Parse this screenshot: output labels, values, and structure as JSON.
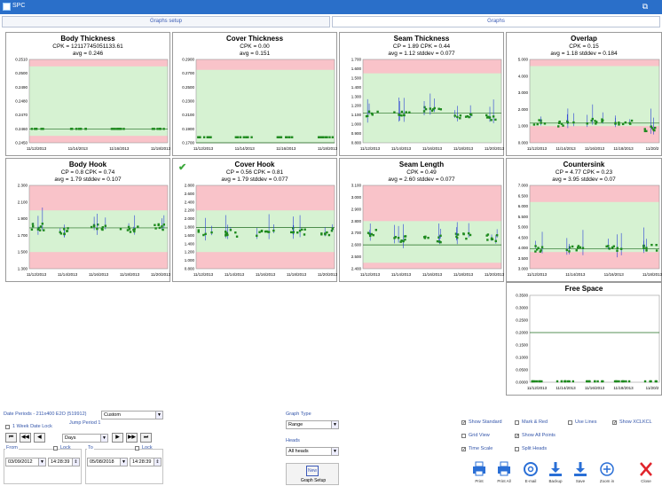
{
  "window": {
    "title": "SPC",
    "restore_glyph": "⧉"
  },
  "tabs": [
    {
      "label": "Graphs setup"
    },
    {
      "label": "Graphs"
    }
  ],
  "charts": [
    {
      "title": "Body Thickness",
      "stats": [
        "CPK = 12117745051133.61",
        "avg = 0.246"
      ],
      "yticks": [
        "0.2510",
        "0.2500",
        "0.2490",
        "0.2480",
        "0.2470",
        "0.2460",
        "0.2450"
      ],
      "xticks": [
        "11/12/2013",
        "11/14/2013",
        "11/16/2013",
        "11/18/2013"
      ]
    },
    {
      "title": "Cover Thickness",
      "stats": [
        "CPK = 0.00",
        "avg = 0.151"
      ],
      "yticks": [
        "0.2900",
        "0.2700",
        "0.2500",
        "0.2300",
        "0.2100",
        "0.1900",
        "0.1700"
      ],
      "xticks": [
        "11/12/2013",
        "11/14/2013",
        "11/16/2013",
        "11/18/2013"
      ]
    },
    {
      "title": "Seam Thickness",
      "stats": [
        "CP = 1.89  CPK = 0.44",
        "avg = 1.12  stddev = 0.077"
      ],
      "yticks": [
        "1.700",
        "1.600",
        "1.500",
        "1.400",
        "1.300",
        "1.200",
        "1.100",
        "1.000",
        "0.900",
        "0.800"
      ],
      "xticks": [
        "11/12/2013",
        "11/14/2013",
        "11/16/2013",
        "11/18/2013",
        "11/20/2013"
      ]
    },
    {
      "title": "Overlap",
      "stats": [
        "CPK = 0.15",
        "avg = 1.18  stddev = 0.184"
      ],
      "yticks": [
        "5.000",
        "4.000",
        "3.000",
        "2.000",
        "1.000",
        "0.000"
      ],
      "xticks": [
        "11/12/2013",
        "11/14/2013",
        "11/16/2013",
        "11/18/2013",
        "11/20/2"
      ]
    },
    {
      "title": "Body Hook",
      "stats": [
        "CP = 0.8  CPK = 0.74",
        "avg = 1.79  stddev = 0.107"
      ],
      "yticks": [
        "2.300",
        "2.100",
        "1.900",
        "1.700",
        "1.500",
        "1.300"
      ],
      "xticks": [
        "11/12/2013",
        "11/14/2013",
        "11/16/2013",
        "11/18/2013",
        "11/20/2013"
      ]
    },
    {
      "title": "Cover Hook",
      "stats": [
        "CP = 0.56  CPK = 0.81",
        "avg = 1.79  stddev = 0.077"
      ],
      "yticks": [
        "2.800",
        "2.600",
        "2.400",
        "2.200",
        "2.000",
        "1.800",
        "1.600",
        "1.400",
        "1.200",
        "1.000",
        "0.800"
      ],
      "xticks": [
        "11/12/2013",
        "11/14/2013",
        "11/16/2013",
        "11/18/2013",
        "11/20/2013"
      ]
    },
    {
      "title": "Seam Length",
      "stats": [
        "CPK = 0.49",
        "avg = 2.60  stddev = 0.077"
      ],
      "yticks": [
        "3.100",
        "3.000",
        "2.900",
        "2.800",
        "2.700",
        "2.600",
        "2.500",
        "2.400"
      ],
      "xticks": [
        "11/12/2013",
        "11/14/2013",
        "11/16/2013",
        "11/18/2013",
        "11/20/2013"
      ]
    },
    {
      "title": "Countersink",
      "stats": [
        "CP = 4.77  CPK = 0.23",
        "avg = 3.95  stddev = 0.07"
      ],
      "yticks": [
        "7.000",
        "6.500",
        "6.000",
        "5.500",
        "5.000",
        "4.500",
        "4.000",
        "3.500",
        "3.000"
      ],
      "xticks": [
        "11/12/2013",
        "11/14/2013",
        "11/16/2013",
        "11/18/2013"
      ]
    },
    {
      "title": "Free Space",
      "stats": [],
      "yticks": [
        "0.3500",
        "0.3000",
        "0.2500",
        "0.2000",
        "0.1500",
        "0.1000",
        "0.0500",
        "0.0000"
      ],
      "xticks": [
        "11/12/2013",
        "11/14/2013",
        "11/16/2013",
        "11/18/2013",
        "11/20/2"
      ]
    }
  ],
  "chart_data": [
    {
      "type": "line",
      "title": "Body Thickness",
      "ylim": [
        0.245,
        0.251
      ],
      "zones": {
        "spec_low": 0.2455,
        "spec_high": 0.2505
      },
      "center": 0.246,
      "x": [
        "11/12/2013",
        "11/14/2013",
        "11/16/2013",
        "11/18/2013"
      ],
      "series": [
        {
          "values": [
            0.246,
            0.246,
            0.246,
            0.246
          ]
        }
      ]
    },
    {
      "type": "line",
      "title": "Cover Thickness",
      "ylim": [
        0.17,
        0.29
      ],
      "zones": {
        "spec_low": 0.17,
        "spec_high": 0.275
      },
      "center": 0.151,
      "x": [
        "11/12/2013",
        "11/14/2013",
        "11/16/2013",
        "11/18/2013"
      ],
      "series": [
        {
          "values": [
            0.178,
            0.178,
            0.178,
            0.178
          ]
        }
      ]
    },
    {
      "type": "line",
      "title": "Seam Thickness",
      "ylim": [
        0.8,
        1.7
      ],
      "zones": {
        "spec_low": 0.8,
        "spec_high": 1.55
      },
      "center": 1.12,
      "x": [
        "11/12/2013",
        "11/14/2013",
        "11/16/2013",
        "11/18/2013",
        "11/20/2013"
      ],
      "series": [
        {
          "values": [
            1.12,
            1.1,
            1.15,
            1.1,
            1.08
          ]
        }
      ]
    },
    {
      "type": "line",
      "title": "Overlap",
      "ylim": [
        0,
        5
      ],
      "zones": {
        "spec_low": 1.0,
        "spec_high": 4.6
      },
      "center": 1.18,
      "x": [
        "11/12/2013",
        "11/14/2013",
        "11/16/2013",
        "11/18/2013",
        "11/20/2013"
      ],
      "series": [
        {
          "values": [
            1.2,
            1.1,
            1.3,
            1.2,
            0.9
          ]
        }
      ]
    },
    {
      "type": "line",
      "title": "Body Hook",
      "ylim": [
        1.3,
        2.3
      ],
      "zones": {
        "spec_low": 1.5,
        "spec_high": 2.0
      },
      "center": 1.79,
      "x": [
        "11/12/2013",
        "11/14/2013",
        "11/16/2013",
        "11/18/2013",
        "11/20/2013"
      ],
      "series": [
        {
          "values": [
            1.8,
            1.75,
            1.8,
            1.78,
            1.8
          ]
        }
      ]
    },
    {
      "type": "line",
      "title": "Cover Hook",
      "ylim": [
        0.8,
        2.8
      ],
      "zones": {
        "spec_low": 1.2,
        "spec_high": 2.2
      },
      "center": 1.79,
      "x": [
        "11/12/2013",
        "11/14/2013",
        "11/16/2013",
        "11/18/2013",
        "11/20/2013"
      ],
      "series": [
        {
          "values": [
            1.65,
            1.65,
            1.65,
            1.7,
            1.68
          ]
        }
      ]
    },
    {
      "type": "line",
      "title": "Seam Length",
      "ylim": [
        2.4,
        3.1
      ],
      "zones": {
        "spec_low": 2.45,
        "spec_high": 2.8
      },
      "center": 2.6,
      "x": [
        "11/12/2013",
        "11/14/2013",
        "11/16/2013",
        "11/18/2013",
        "11/20/2013"
      ],
      "series": [
        {
          "values": [
            2.7,
            2.65,
            2.65,
            2.68,
            2.66
          ]
        }
      ]
    },
    {
      "type": "line",
      "title": "Countersink",
      "ylim": [
        3.0,
        7.0
      ],
      "zones": {
        "spec_low": 3.8,
        "spec_high": 6.2
      },
      "center": 3.95,
      "x": [
        "11/12/2013",
        "11/14/2013",
        "11/16/2013",
        "11/18/2013"
      ],
      "series": [
        {
          "values": [
            3.95,
            3.95,
            3.98,
            4.0
          ]
        }
      ]
    },
    {
      "type": "line",
      "title": "Free Space",
      "ylim": [
        0,
        0.35
      ],
      "center": 0.2,
      "x": [
        "11/12/2013",
        "11/14/2013",
        "11/16/2013",
        "11/18/2013",
        "11/20/2013"
      ],
      "series": [
        {
          "values": [
            0.0,
            0.0,
            0.0,
            0.0,
            0.0
          ]
        }
      ]
    }
  ],
  "controls": {
    "date_periods_label": "Date Periods - 211x400 E2O (519912)",
    "date_periods_value": "Custom",
    "week_lock_label": "1 Week Date Lock",
    "jump_label": "Jump Period 1",
    "nav_buttons": [
      "⏮",
      "◀◀",
      "◀",
      "▶",
      "▶▶",
      "⏭"
    ],
    "days_value": "Days",
    "from_label": "From",
    "to_label": "To",
    "lock_label": "Lock",
    "from_date": "03/09/2012",
    "from_time": "14:28:39",
    "to_date": "05/08/2018",
    "to_time": "14:28:39",
    "graph_type_label": "Graph Type",
    "graph_type_value": "Range",
    "heads_label": "Heads",
    "heads_value": "All heads",
    "graph_setup_label": "Graph Setup",
    "graph_setup_icon_text": "New",
    "checkboxes": [
      {
        "label": "Show Standard",
        "checked": true
      },
      {
        "label": "Grid View",
        "checked": false
      },
      {
        "label": "Time Scale",
        "checked": true
      },
      {
        "label": "Mark & Red",
        "checked": false
      },
      {
        "label": "Show All Points",
        "checked": true
      },
      {
        "label": "Split Heads",
        "checked": false
      },
      {
        "label": "Use Lines",
        "checked": false
      },
      {
        "label": "Show XCLKCL",
        "checked": true
      }
    ]
  },
  "toolbar": [
    {
      "label": "Print",
      "icon": "printer-icon"
    },
    {
      "label": "Print All",
      "icon": "printer-all-icon"
    },
    {
      "label": "E-mail",
      "icon": "email-icon"
    },
    {
      "label": "Backup",
      "icon": "download-icon"
    },
    {
      "label": "Save",
      "icon": "save-icon"
    },
    {
      "label": "Zoom in",
      "icon": "zoom-in-icon"
    },
    {
      "label": "Close",
      "icon": "close-icon"
    }
  ],
  "colors": {
    "spec_zone": "#f9c3c9",
    "ok_zone": "#d6f2d2",
    "series": "#1e8a1e",
    "error_bar": "#2a3fd6",
    "center": "#1f6b1f",
    "title_bar": "#2a6fc9"
  }
}
